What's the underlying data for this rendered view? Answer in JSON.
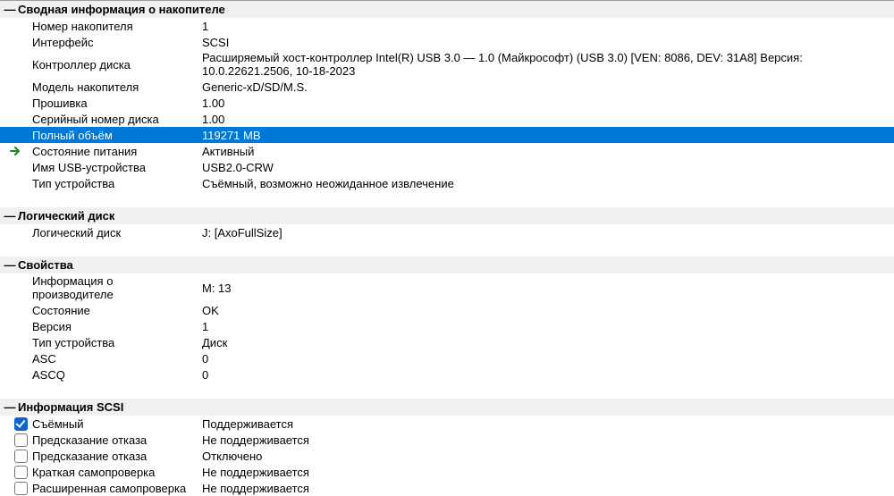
{
  "sections": {
    "summary": {
      "title": "Сводная информация о накопителе",
      "rows": [
        {
          "name": "drive-number",
          "label": "Номер накопителя",
          "value": "1"
        },
        {
          "name": "interface",
          "label": "Интерфейс",
          "value": "SCSI"
        },
        {
          "name": "disk-controller",
          "label": "Контроллер диска",
          "value": "Расширяемый хост-контроллер Intel(R) USB 3.0 — 1.0 (Майкрософт) (USB 3.0) [VEN: 8086, DEV: 31A8] Версия: 10.0.22621.2506, 10-18-2023"
        },
        {
          "name": "drive-model",
          "label": "Модель накопителя",
          "value": "Generic-xD/SD/M.S."
        },
        {
          "name": "firmware",
          "label": "Прошивка",
          "value": "1.00"
        },
        {
          "name": "serial-number",
          "label": "Серийный номер диска",
          "value": "1.00"
        },
        {
          "name": "full-size",
          "label": "Полный объём",
          "value": "119271 MB",
          "selected": true
        },
        {
          "name": "power-state",
          "label": "Состояние питания",
          "value": "Активный",
          "arrow": true
        },
        {
          "name": "usb-device-name",
          "label": "Имя USB-устройства",
          "value": "USB2.0-CRW"
        },
        {
          "name": "device-type",
          "label": "Тип устройства",
          "value": "Съёмный, возможно неожиданное извлечение"
        }
      ]
    },
    "logical": {
      "title": "Логический диск",
      "rows": [
        {
          "name": "logical-disk",
          "label": "Логический диск",
          "value": "J: [AxoFullSize]"
        }
      ]
    },
    "properties": {
      "title": "Свойства",
      "rows": [
        {
          "name": "vendor-info",
          "label": "Информация о производителе",
          "value": "M: 13"
        },
        {
          "name": "state",
          "label": "Состояние",
          "value": "OK"
        },
        {
          "name": "version",
          "label": "Версия",
          "value": "1"
        },
        {
          "name": "dev-type",
          "label": "Тип устройства",
          "value": "Диск"
        },
        {
          "name": "asc",
          "label": "ASC",
          "value": "0"
        },
        {
          "name": "ascq",
          "label": "ASCQ",
          "value": "0"
        }
      ]
    },
    "scsi": {
      "title": "Информация SCSI",
      "rows": [
        {
          "name": "removable",
          "label": "Съёмный",
          "value": "Поддерживается",
          "checked": true
        },
        {
          "name": "fail-predict-1",
          "label": "Предсказание отказа",
          "value": "Не поддерживается",
          "checked": false
        },
        {
          "name": "fail-predict-2",
          "label": "Предсказание отказа",
          "value": "Отключено",
          "checked": false
        },
        {
          "name": "short-selftest",
          "label": "Краткая самопроверка",
          "value": "Не поддерживается",
          "checked": false
        },
        {
          "name": "ext-selftest",
          "label": "Расширенная самопроверка",
          "value": "Не поддерживается",
          "checked": false
        }
      ]
    }
  }
}
